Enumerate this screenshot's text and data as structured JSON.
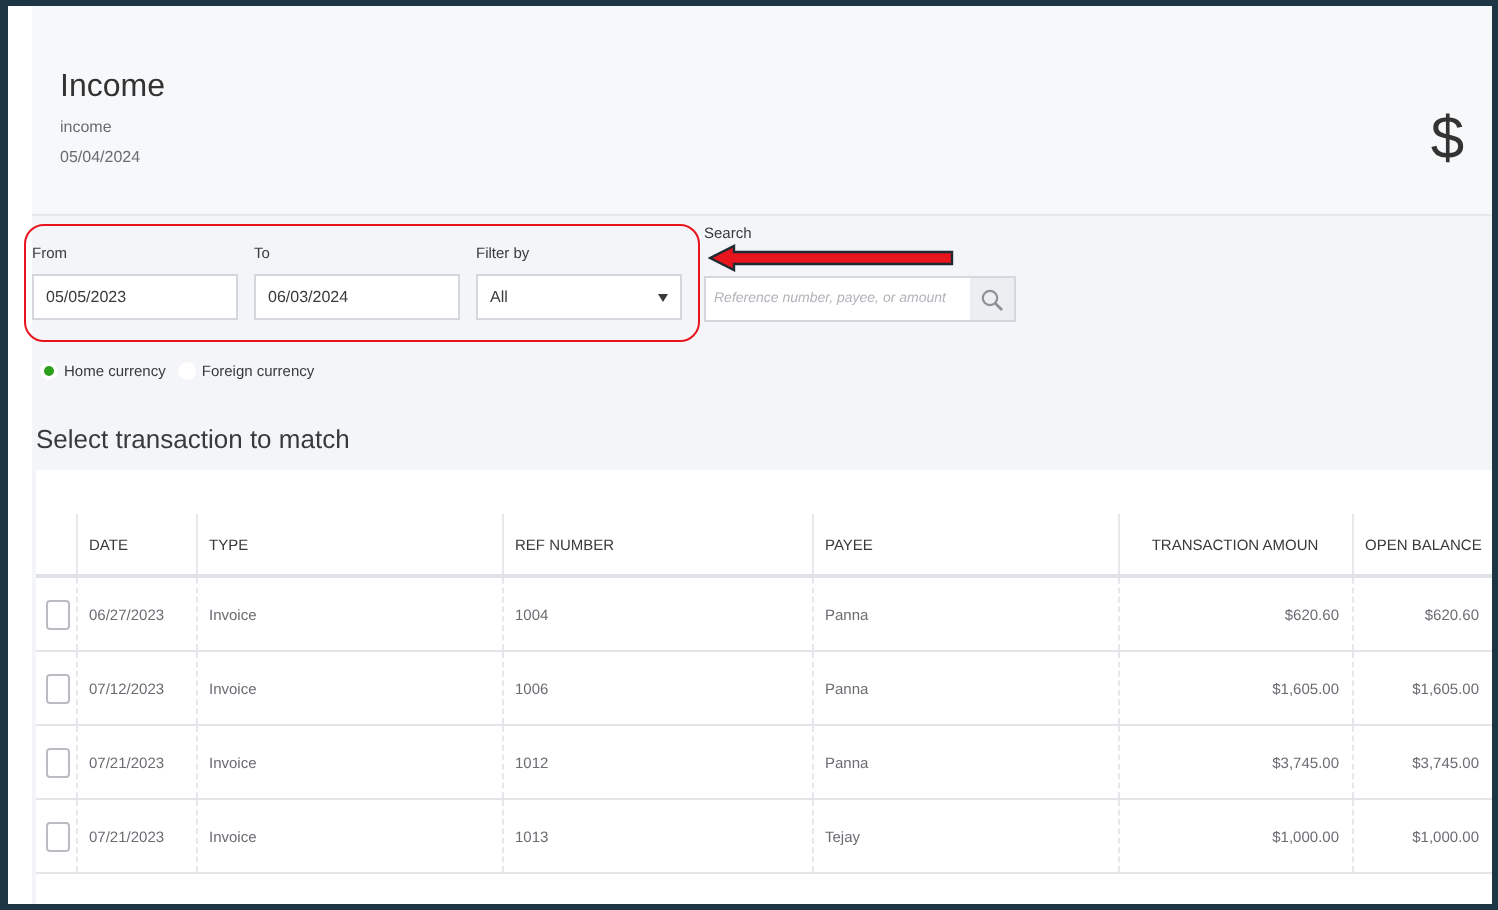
{
  "header": {
    "title": "Income",
    "subtitle": "income",
    "date": "05/04/2024",
    "amount": "$"
  },
  "filters": {
    "from": {
      "label": "From",
      "value": "05/05/2023"
    },
    "to": {
      "label": "To",
      "value": "06/03/2024"
    },
    "filter_by": {
      "label": "Filter by",
      "value": "All"
    },
    "search": {
      "label": "Search",
      "placeholder": "Reference number, payee, or amount"
    }
  },
  "currency_options": [
    {
      "label": "Home currency",
      "selected": true
    },
    {
      "label": "Foreign currency",
      "selected": false
    }
  ],
  "section_title": "Select transaction to match",
  "table": {
    "columns": [
      "DATE",
      "TYPE",
      "REF NUMBER",
      "PAYEE",
      "TRANSACTION AMOUN",
      "OPEN BALANCE"
    ],
    "rows": [
      {
        "checked": false,
        "cells": [
          "06/27/2023",
          "Invoice",
          "1004",
          "Panna",
          "$620.60",
          "$620.60"
        ]
      },
      {
        "checked": false,
        "cells": [
          "07/12/2023",
          "Invoice",
          "1006",
          "Panna",
          "$1,605.00",
          "$1,605.00"
        ]
      },
      {
        "checked": false,
        "cells": [
          "07/21/2023",
          "Invoice",
          "1012",
          "Panna",
          "$3,745.00",
          "$3,745.00"
        ]
      },
      {
        "checked": false,
        "cells": [
          "07/21/2023",
          "Invoice",
          "1013",
          "Tejay",
          "$1,000.00",
          "$1,000.00"
        ]
      }
    ]
  }
}
